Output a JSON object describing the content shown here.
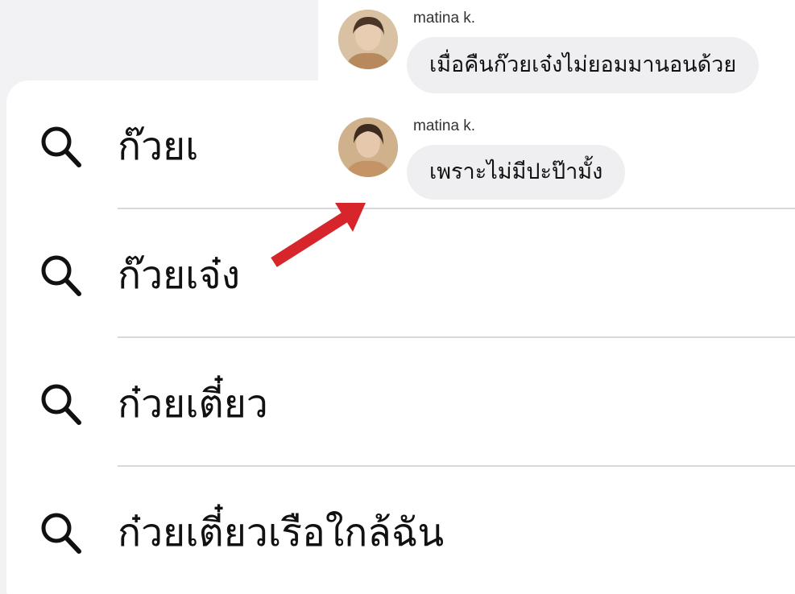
{
  "suggestions": [
    {
      "text": "ก๊วยเ",
      "icon": "search-icon"
    },
    {
      "text": "ก๊วยเจ๋ง",
      "icon": "search-icon"
    },
    {
      "text": "ก๋วยเตี๋ยว",
      "icon": "search-icon"
    },
    {
      "text": "ก๋วยเตี๋ยวเรือใกล้ฉัน",
      "icon": "search-icon"
    }
  ],
  "chat": {
    "messages": [
      {
        "sender": "matina k.",
        "text": "เมื่อคืนก๊วยเจ๋งไม่ยอมมานอนด้วย",
        "avatar": "profile-photo"
      },
      {
        "sender": "matina k.",
        "text": "เพราะไม่มีปะป๊ามั้ง",
        "avatar": "profile-photo"
      }
    ]
  },
  "annotation": {
    "icon": "red-arrow-icon",
    "color": "#d6262b"
  },
  "colors": {
    "background": "#f2f2f4",
    "card": "#ffffff",
    "bubble": "#efeff1",
    "divider": "#d8d8dc"
  }
}
